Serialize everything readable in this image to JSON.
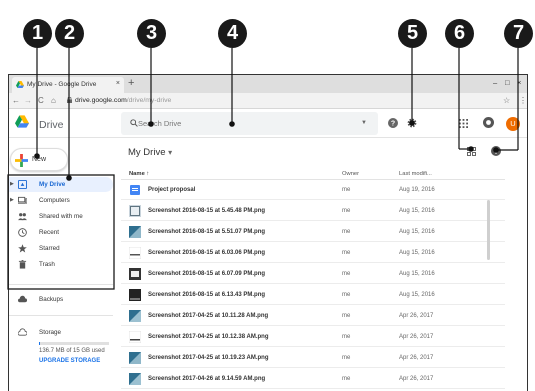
{
  "browser": {
    "tab_title": "My Drive - Google Drive",
    "tab_close": "×",
    "new_tab": "+",
    "minimize": "–",
    "maximize": "□",
    "close": "×",
    "back": "←",
    "forward": "→",
    "reload": "C",
    "home": "⌂",
    "url_host": "drive.google.com",
    "url_path": "/drive/my-drive",
    "bookmark_star": "☆",
    "menu_dots": "⋮"
  },
  "header": {
    "app_name": "Drive",
    "search_placeholder": "Search Drive",
    "search_dropdown": "▼",
    "avatar_initial": "U"
  },
  "sidebar": {
    "new_label": "New",
    "items": [
      {
        "label": "My Drive",
        "icon": "my-drive-icon",
        "active": true,
        "expandable": true
      },
      {
        "label": "Computers",
        "icon": "computer-icon",
        "active": false,
        "expandable": true
      },
      {
        "label": "Shared with me",
        "icon": "people-icon",
        "active": false,
        "expandable": false
      },
      {
        "label": "Recent",
        "icon": "clock-icon",
        "active": false,
        "expandable": false
      },
      {
        "label": "Starred",
        "icon": "star-icon",
        "active": false,
        "expandable": false
      },
      {
        "label": "Trash",
        "icon": "trash-icon",
        "active": false,
        "expandable": false
      }
    ],
    "backups_label": "Backups",
    "storage_label": "Storage",
    "storage_used": "136.7 MB of 15 GB used",
    "storage_fraction": 0.009,
    "upgrade_label": "UPGRADE STORAGE",
    "expand_arrow": "▶"
  },
  "main": {
    "title": "My Drive",
    "title_caret": "▾",
    "columns": {
      "name": "Name",
      "sort_arrow": "↑",
      "owner": "Owner",
      "modified": "Last modifi..."
    },
    "files": [
      {
        "name": "Project proposal",
        "owner": "me",
        "modified": "Aug 19, 2016",
        "type": "doc"
      },
      {
        "name": "Screenshot 2016-08-15 at 5.45.48 PM.png",
        "owner": "me",
        "modified": "Aug 15, 2016",
        "type": "image"
      },
      {
        "name": "Screenshot 2016-08-15 at 5.51.07 PM.png",
        "owner": "me",
        "modified": "Aug 15, 2016",
        "type": "image"
      },
      {
        "name": "Screenshot 2016-08-15 at 6.03.06 PM.png",
        "owner": "me",
        "modified": "Aug 15, 2016",
        "type": "image"
      },
      {
        "name": "Screenshot 2016-08-15 at 6.07.09 PM.png",
        "owner": "me",
        "modified": "Aug 15, 2016",
        "type": "image"
      },
      {
        "name": "Screenshot 2016-08-15 at 6.13.43 PM.png",
        "owner": "me",
        "modified": "Aug 15, 2016",
        "type": "image"
      },
      {
        "name": "Screenshot 2017-04-25 at 10.11.28 AM.png",
        "owner": "me",
        "modified": "Apr 26, 2017",
        "type": "image"
      },
      {
        "name": "Screenshot 2017-04-25 at 10.12.38 AM.png",
        "owner": "me",
        "modified": "Apr 26, 2017",
        "type": "image"
      },
      {
        "name": "Screenshot 2017-04-25 at 10.19.23 AM.png",
        "owner": "me",
        "modified": "Apr 26, 2017",
        "type": "image"
      },
      {
        "name": "Screenshot 2017-04-26 at 9.14.59 AM.png",
        "owner": "me",
        "modified": "Apr 26, 2017",
        "type": "image"
      }
    ]
  },
  "callouts": [
    "1",
    "2",
    "3",
    "4",
    "5",
    "6",
    "7"
  ],
  "colors": {
    "accent": "#1a73e8",
    "active_bg": "#e8f0fe",
    "callout": "#1a1a1a",
    "avatar": "#ef6c00"
  }
}
